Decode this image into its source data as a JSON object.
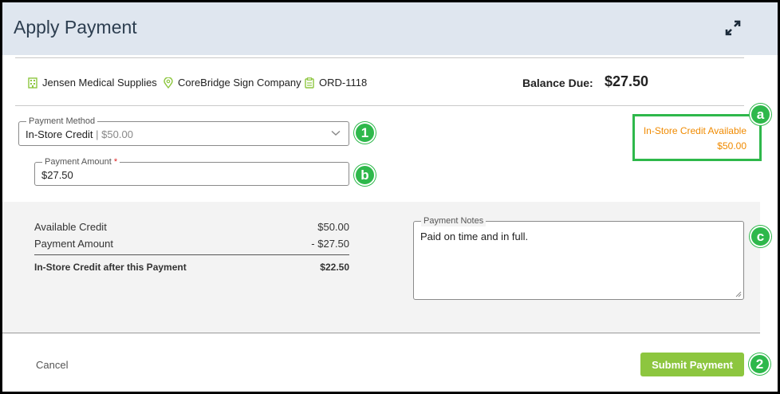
{
  "dialog": {
    "title": "Apply Payment"
  },
  "summary": {
    "customer": "Jensen Medical Supplies",
    "company": "CoreBridge Sign Company",
    "order": "ORD-1118",
    "balance_label": "Balance Due:",
    "balance_value": "$27.50"
  },
  "payment_method": {
    "label": "Payment Method",
    "value": "In-Store Credit",
    "separator": " | ",
    "amount": "$50.00"
  },
  "payment_amount": {
    "label": "Payment Amount",
    "required_mark": "*",
    "value": "$27.50"
  },
  "credit_available": {
    "label": "In-Store Credit Available",
    "value": "$50.00"
  },
  "calculation": [
    {
      "label": "Available Credit",
      "value": "$50.00"
    },
    {
      "label": "Payment Amount",
      "value": "- $27.50"
    }
  ],
  "calculation_total": {
    "label": "In-Store Credit after this Payment",
    "value": "$22.50"
  },
  "notes": {
    "label": "Payment Notes",
    "value": "Paid on time and in full."
  },
  "footer": {
    "cancel_label": "Cancel",
    "submit_label": "Submit Payment"
  },
  "callouts": {
    "a": "a",
    "b": "b",
    "c": "c",
    "one": "1",
    "two": "2"
  },
  "colors": {
    "accent": "#8dc63f",
    "callout": "#2eb84b",
    "credit": "#f08a00",
    "header": "#dfe6ef"
  }
}
